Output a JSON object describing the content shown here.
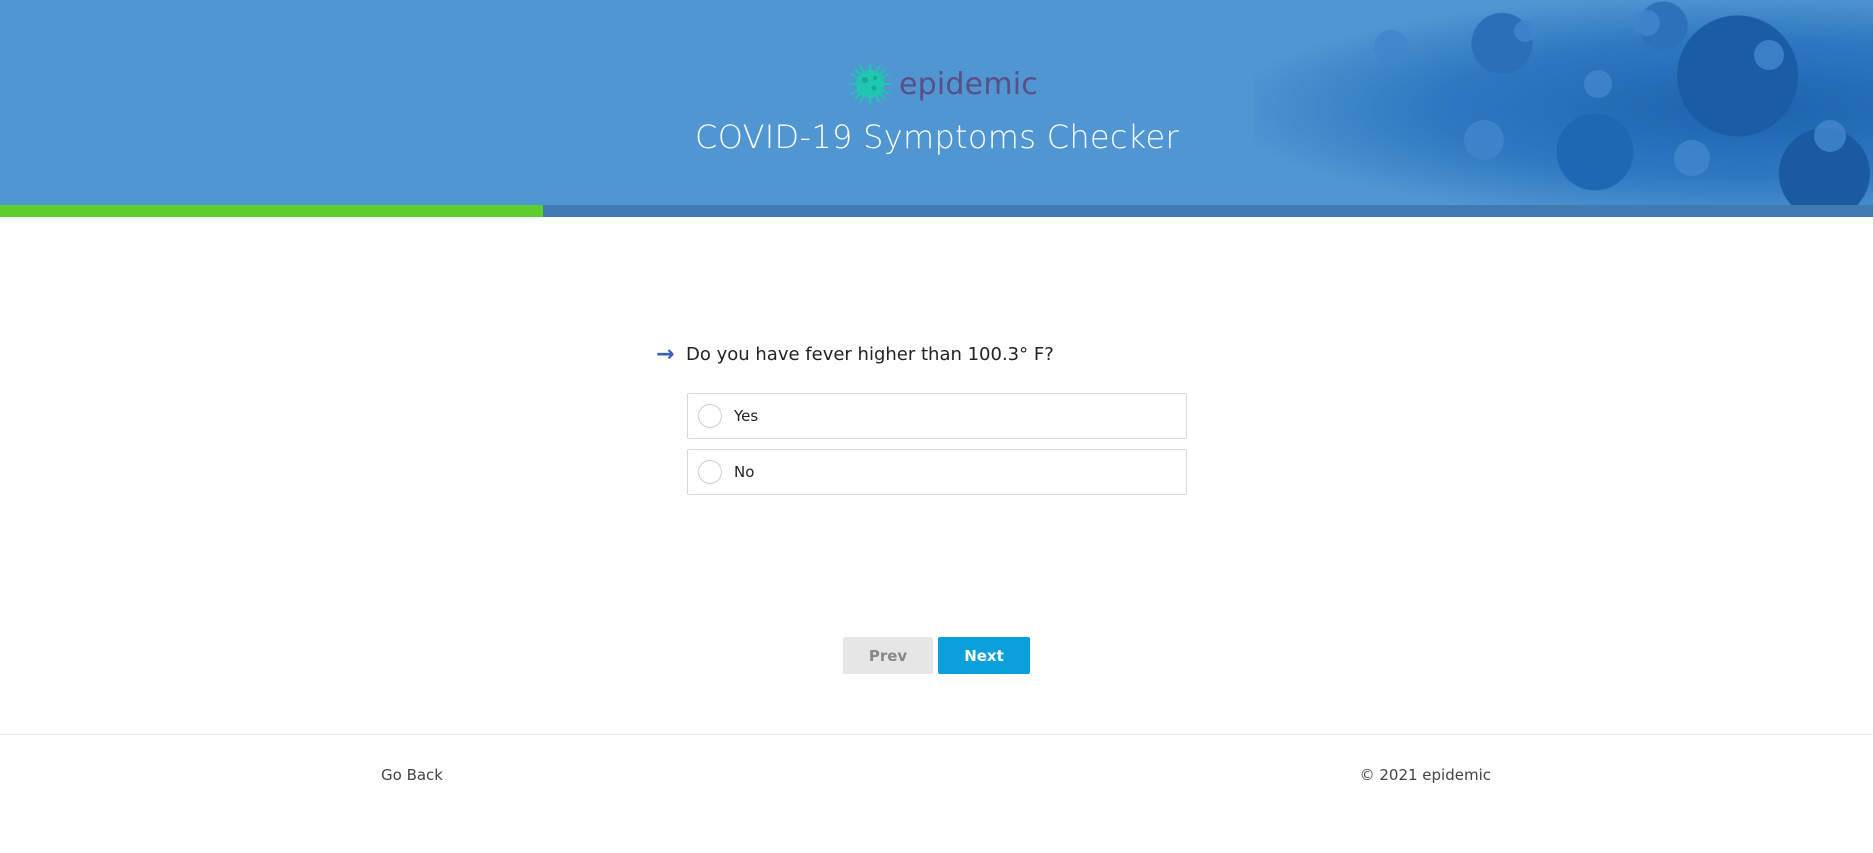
{
  "brand": {
    "name": "epidemic",
    "logo_icon": "virus-icon",
    "logo_color": "#1fc7b0"
  },
  "header": {
    "title": "COVID-19 Symptoms Checker",
    "background_color": "#5096d2"
  },
  "progress": {
    "fraction": 0.29,
    "fill_color": "#5ccf2d"
  },
  "question": {
    "arrow_icon": "arrow-right-icon",
    "text": "Do you have fever higher than 100.3° F?",
    "options": [
      {
        "label": "Yes",
        "selected": false
      },
      {
        "label": "No",
        "selected": false
      }
    ]
  },
  "navigation": {
    "prev_label": "Prev",
    "next_label": "Next",
    "next_color": "#0aa0dc"
  },
  "footer": {
    "go_back_label": "Go Back",
    "copyright": "© 2021 epidemic"
  }
}
